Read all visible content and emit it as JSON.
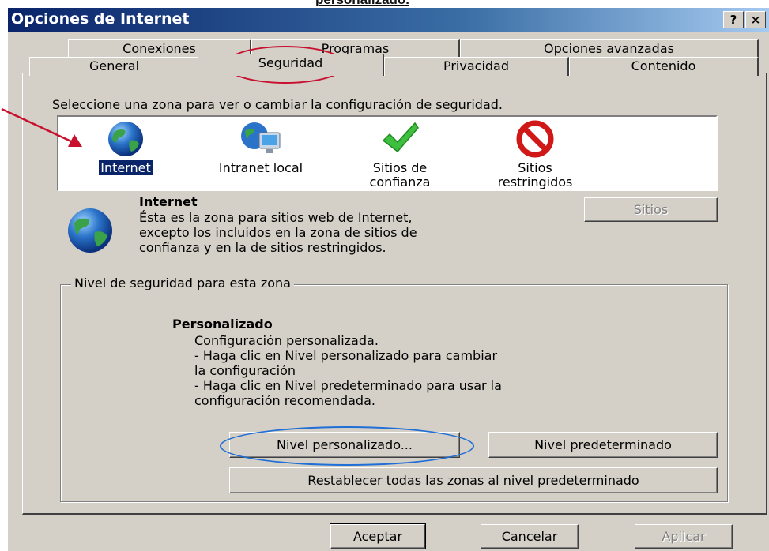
{
  "caption": "personalizado.",
  "window": {
    "title": "Opciones de Internet",
    "help_label": "?",
    "close_label": "×"
  },
  "tabs_back": [
    {
      "label": "Conexiones"
    },
    {
      "label": "Programas"
    },
    {
      "label": "Opciones avanzadas"
    }
  ],
  "tabs_front": [
    {
      "label": "General"
    },
    {
      "label": "Seguridad"
    },
    {
      "label": "Privacidad"
    },
    {
      "label": "Contenido"
    }
  ],
  "zones": {
    "prompt": "Seleccione una zona para ver o cambiar la configuración de seguridad.",
    "items": [
      {
        "label": "Internet",
        "icon": "globe-icon",
        "selected": true
      },
      {
        "label": "Intranet local",
        "icon": "intranet-icon"
      },
      {
        "label": "Sitios de confianza",
        "line1": "Sitios de",
        "line2": "confianza",
        "icon": "checkmark-icon"
      },
      {
        "label": "Sitios restringidos",
        "line1": "Sitios",
        "line2": "restringidos",
        "icon": "no-entry-icon"
      }
    ]
  },
  "zone_desc": {
    "title": "Internet",
    "text": "Ésta es la zona para sitios web de Internet,\nexcepto los incluidos en la zona de sitios de\nconfianza y en la de sitios restringidos.",
    "sites_button": "Sitios"
  },
  "security_level": {
    "legend": "Nivel de seguridad para esta zona",
    "title": "Personalizado",
    "text": "Configuración personalizada.\n- Haga clic en Nivel personalizado para cambiar\n  la configuración\n- Haga clic en Nivel predeterminado para usar la\n  configuración recomendada.",
    "custom_button": "Nivel personalizado...",
    "default_button": "Nivel predeterminado",
    "reset_button": "Restablecer todas las zonas al nivel predeterminado"
  },
  "footer": {
    "ok": "Aceptar",
    "cancel": "Cancelar",
    "apply": "Aplicar"
  },
  "colors": {
    "annotation_red": "#c8102e",
    "annotation_blue": "#1f6fd6",
    "selection": "#0a246a",
    "dialog_bg": "#d4d0c8"
  }
}
